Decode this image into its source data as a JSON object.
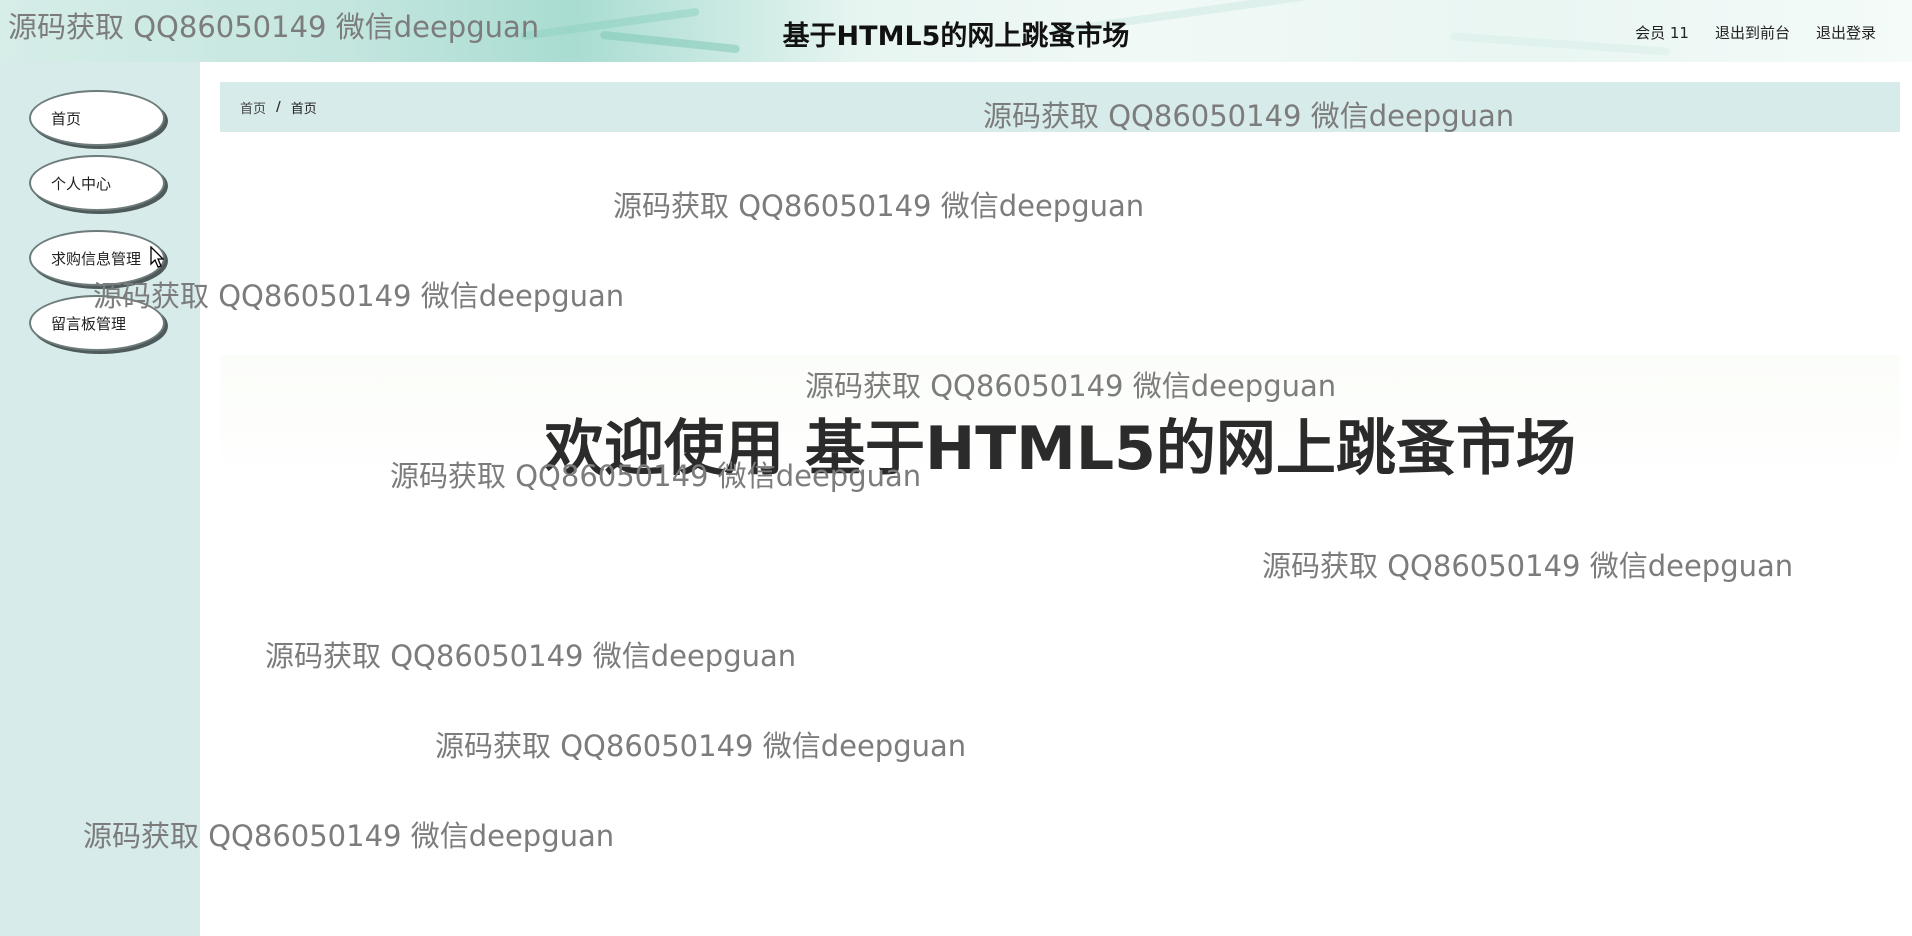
{
  "header": {
    "title": "基于HTML5的网上跳蚤市场",
    "links": [
      "会员 11",
      "退出到前台",
      "退出登录"
    ]
  },
  "sidebar": {
    "items": [
      {
        "label": "首页"
      },
      {
        "label": "个人中心"
      },
      {
        "label": "求购信息管理"
      },
      {
        "label": "留言板管理"
      }
    ]
  },
  "breadcrumb": {
    "home": "首页",
    "separator": "/",
    "current": "首页"
  },
  "main": {
    "welcome": "欢迎使用 基于HTML5的网上跳蚤市场"
  },
  "watermark": {
    "text": "源码获取 QQ86050149 微信deepguan"
  },
  "colors": {
    "sidebar_bg": "#d7ebea",
    "breadcrumb_bg": "#d7ebea",
    "watermark": "#7c7c7c"
  }
}
